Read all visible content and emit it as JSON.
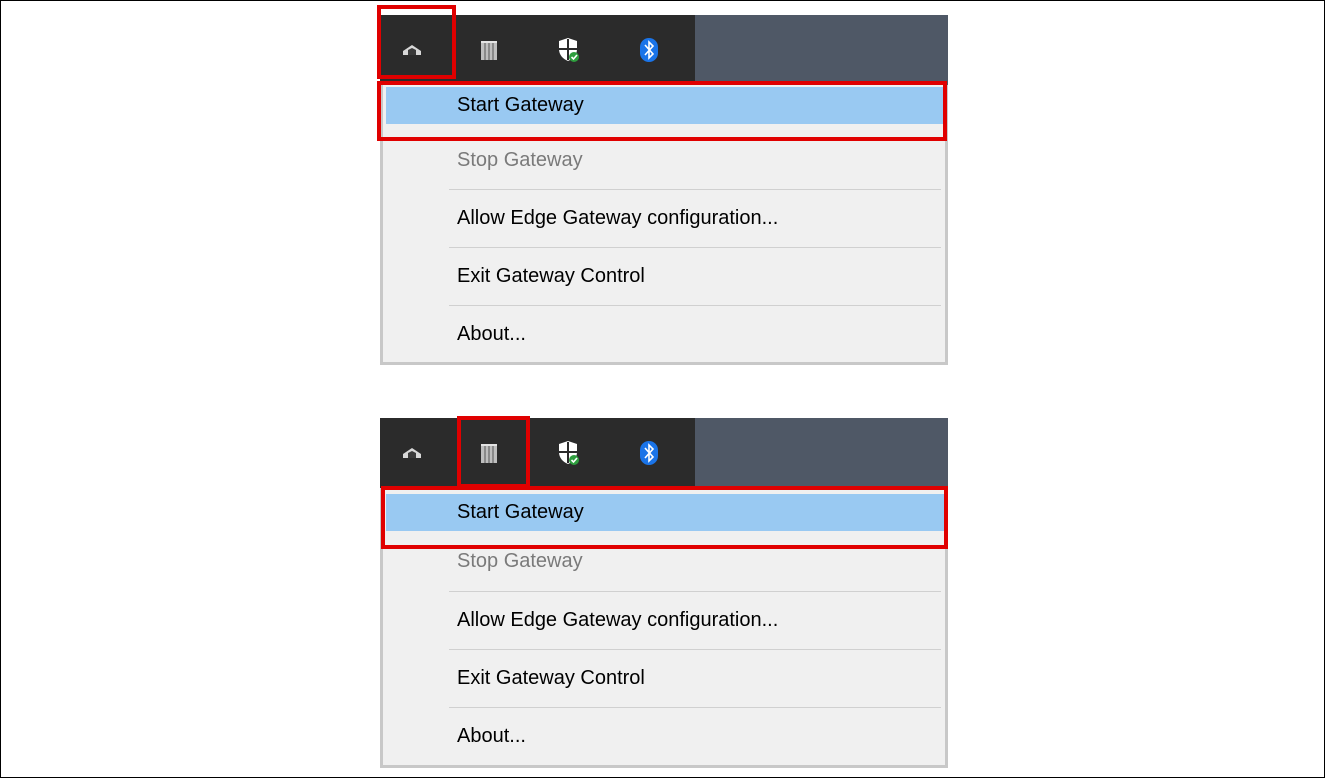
{
  "colors": {
    "highlight": "#99c9f2",
    "annotation": "#e00000",
    "taskbar": "#2b2b2b",
    "taskbar_right": "#4f5866",
    "menu_bg": "#f0f0f0"
  },
  "tray_icons": [
    "gateway-cloud-icon",
    "plc-rack-icon",
    "windows-security-icon",
    "bluetooth-icon"
  ],
  "screens": [
    {
      "menu": {
        "items": [
          {
            "label": "Start Gateway",
            "state": "highlighted"
          },
          {
            "label": "Stop Gateway",
            "state": "disabled"
          },
          {
            "label": "Allow Edge Gateway configuration...",
            "state": "normal"
          },
          {
            "label": "Exit Gateway Control",
            "state": "normal"
          },
          {
            "label": "About...",
            "state": "normal"
          }
        ]
      }
    },
    {
      "menu": {
        "items": [
          {
            "label": "Start Gateway",
            "state": "highlighted"
          },
          {
            "label": "Stop Gateway",
            "state": "disabled"
          },
          {
            "label": "Allow Edge Gateway configuration...",
            "state": "normal"
          },
          {
            "label": "Exit Gateway Control",
            "state": "normal"
          },
          {
            "label": "About...",
            "state": "normal"
          }
        ]
      }
    }
  ]
}
